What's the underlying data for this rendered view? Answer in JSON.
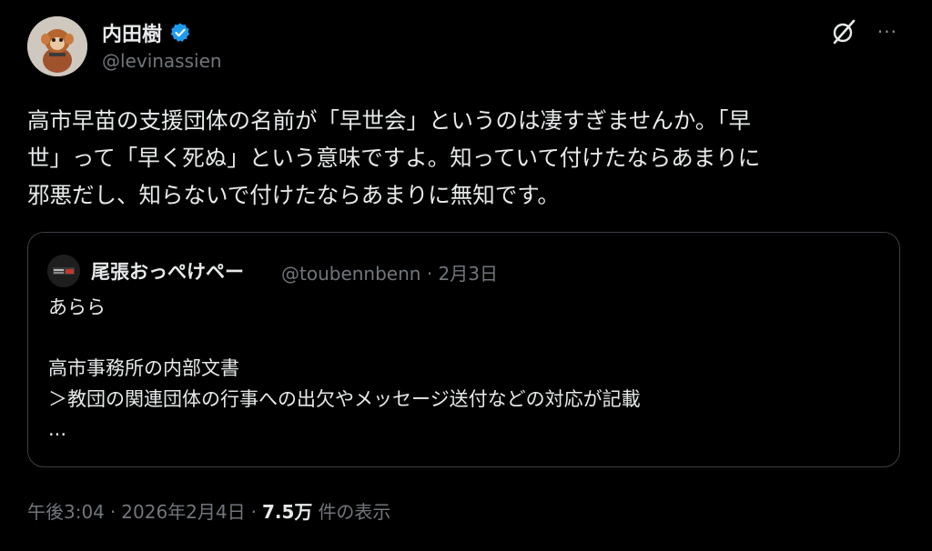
{
  "author": {
    "display_name": "内田樹",
    "handle": "@levinassien",
    "verified": true,
    "avatar_icon": "monkey-avatar",
    "verified_icon": "verified-badge-icon"
  },
  "actions": {
    "grok_icon": "grok-icon",
    "more_label": "···"
  },
  "tweet": {
    "text": "高市早苗の支援団体の名前が「早世会」というのは凄すぎませんか。「早\n世」って「早く死ぬ」という意味ですよ。知っていて付けたならあまりに\n邪悪だし、知らないで付けたならあまりに無知です。"
  },
  "quote": {
    "display_name": "尾張おっぺけペー",
    "meta": "@toubennbenn · 2月3日",
    "text": "あらら\n\n高市事務所の内部文書\n＞教団の関連団体の行事への出欠やメッセージ送付などの対応が記載\n..."
  },
  "footer": {
    "time": "午後3:04",
    "sep1": "·",
    "date": "2026年2月4日",
    "sep2": "·",
    "views_count": "7.5万",
    "views_label": "件の表示"
  },
  "colors": {
    "background": "#000000",
    "text": "#e7e9ea",
    "secondary": "#71767b",
    "verified": "#1d9bf0",
    "border": "#3b3f44"
  }
}
